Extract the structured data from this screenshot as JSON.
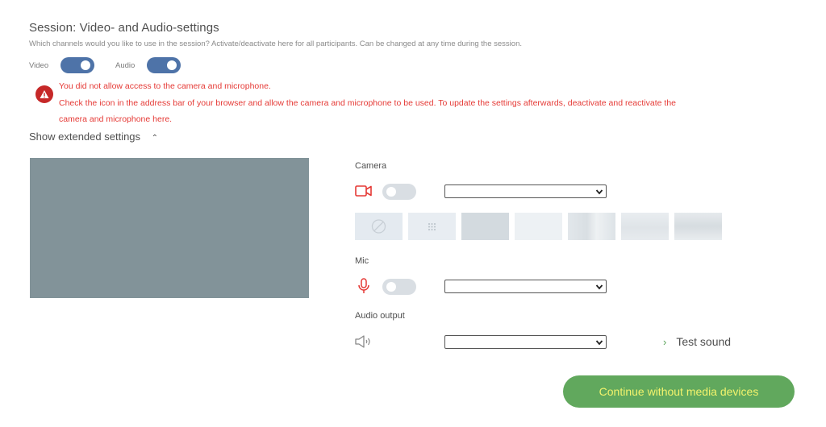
{
  "session": {
    "title": "Session: Video- and Audio-settings",
    "subtitle": "Which channels would you like to use in the session? Activate/deactivate here for all participants. Can be changed at any time during the session."
  },
  "channels": {
    "video_label": "Video",
    "video_on": true,
    "audio_label": "Audio",
    "audio_on": true
  },
  "error": {
    "line1": "You did not allow access to the camera and microphone.",
    "line2": "Check the icon in the address bar of your browser and allow the camera and microphone to be used. To update the settings afterwards, deactivate and reactivate the",
    "line3": "camera and microphone here."
  },
  "extended": {
    "label": "Show extended settings",
    "icon": "chevron-up-icon"
  },
  "devices": {
    "camera_label": "Camera",
    "camera_icon": "camera-icon",
    "camera_enabled": false,
    "camera_select": "",
    "mic_label": "Mic",
    "mic_icon": "microphone-icon",
    "mic_enabled": false,
    "mic_select": "",
    "output_label": "Audio output",
    "output_icon": "speaker-icon",
    "output_select": ""
  },
  "backgrounds": [
    "none",
    "blur",
    "background-3",
    "background-4",
    "background-5",
    "background-6",
    "background-7"
  ],
  "test_sound": "Test sound",
  "continue_label": "Continue without media devices",
  "colors": {
    "accent_blue": "#4e73a8",
    "error_red": "#e53935",
    "button_green": "#61a85d",
    "button_text": "#f3f36c"
  }
}
